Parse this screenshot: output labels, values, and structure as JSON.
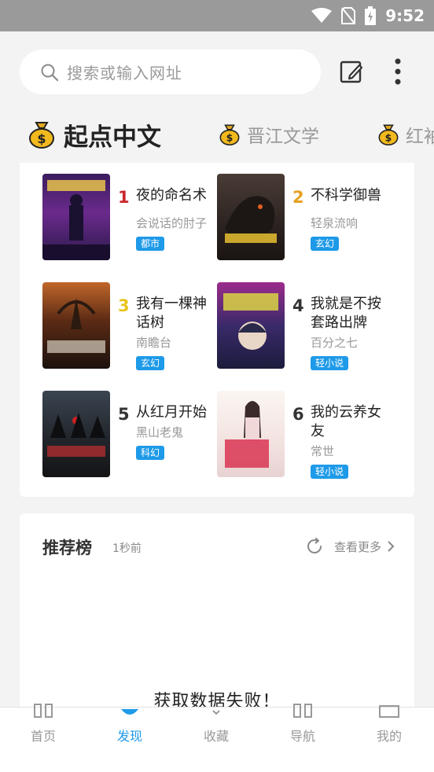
{
  "status_bar": {
    "time": "9:52"
  },
  "search": {
    "placeholder": "搜索或输入网址"
  },
  "tabs": [
    {
      "label": "起点中文",
      "active": true
    },
    {
      "label": "晋江文学",
      "active": false
    },
    {
      "label": "红袖",
      "active": false
    }
  ],
  "books": [
    {
      "rank": "1",
      "title": "夜的命名术",
      "author": "会说话的肘子",
      "tag": "都市",
      "rank_color": "#c8282d"
    },
    {
      "rank": "2",
      "title": "不科学御兽",
      "author": "轻泉流响",
      "tag": "玄幻",
      "rank_color": "#e6a020"
    },
    {
      "rank": "3",
      "title": "我有一棵神话树",
      "author": "南瞻台",
      "tag": "玄幻",
      "rank_color": "#e8c41e"
    },
    {
      "rank": "4",
      "title": "我就是不按套路出牌",
      "author": "百分之七",
      "tag": "轻小说",
      "rank_color": "#333333"
    },
    {
      "rank": "5",
      "title": "从红月开始",
      "author": "黑山老鬼",
      "tag": "科幻",
      "rank_color": "#333333"
    },
    {
      "rank": "6",
      "title": "我的云养女友",
      "author": "常世",
      "tag": "轻小说",
      "rank_color": "#333333"
    }
  ],
  "recommend": {
    "title": "推荐榜",
    "time": "1秒前",
    "more": "查看更多",
    "error": "获取数据失败！"
  },
  "bottom_nav": [
    {
      "label": "首页",
      "icon": "home-icon"
    },
    {
      "label": "发现",
      "icon": "discover-icon"
    },
    {
      "label": "收藏",
      "icon": "favorite-icon"
    },
    {
      "label": "导航",
      "icon": "navigation-icon"
    },
    {
      "label": "我的",
      "icon": "profile-icon"
    }
  ],
  "colors": {
    "accent": "#1e9ae8",
    "status_bar": "#9a9a9a",
    "background": "#f3f3f3"
  }
}
